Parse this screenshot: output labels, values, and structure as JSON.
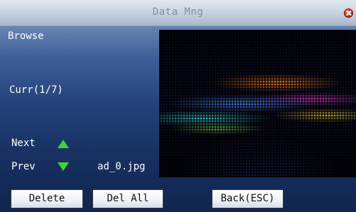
{
  "window": {
    "title": "Data Mng"
  },
  "panel": {
    "browse_label": "Browse",
    "current_label": "Curr(1/7)",
    "next_label": "Next",
    "prev_label": "Prev",
    "filename": "ad_0.jpg"
  },
  "buttons": {
    "delete": "Delete",
    "delete_all": "Del All",
    "back": "Back(ESC)"
  },
  "icons": {
    "close": "close-icon",
    "next": "arrow-up-icon",
    "prev": "arrow-down-icon"
  },
  "colors": {
    "close_button": "#e23a25",
    "nav_arrows": "#3fd33a"
  }
}
